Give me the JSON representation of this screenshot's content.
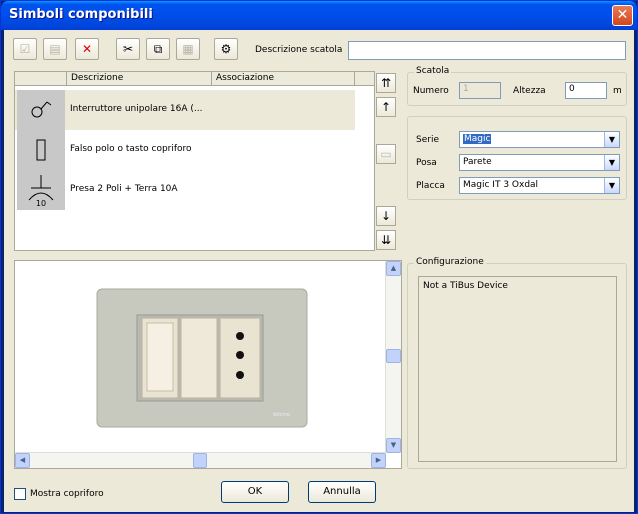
{
  "window": {
    "title": "Simboli componibili",
    "close_glyph": "✕"
  },
  "toolbar": {
    "buttons": [
      {
        "icon": "edit-icon",
        "glyph": "☑",
        "enabled": false
      },
      {
        "icon": "properties-icon",
        "glyph": "▤",
        "enabled": false
      },
      {
        "icon": "delete-icon",
        "glyph": "✕",
        "enabled": true
      },
      {
        "icon": "cut-icon",
        "glyph": "✂",
        "enabled": true
      },
      {
        "icon": "copy-icon",
        "glyph": "⧉",
        "enabled": true
      },
      {
        "icon": "paste-icon",
        "glyph": "▦",
        "enabled": false
      },
      {
        "icon": "settings-icon",
        "glyph": "⚙",
        "enabled": true
      }
    ],
    "descrizione_scatola_label": "Descrizione scatola",
    "descrizione_scatola_value": ""
  },
  "list": {
    "columns": [
      "Descrizione",
      "Associazione"
    ],
    "rows": [
      {
        "description": "Interruttore unipolare 16A (...",
        "association": "",
        "symbol": "switch-symbol-icon",
        "selected": true
      },
      {
        "description": "Falso polo o tasto copriforo",
        "association": "",
        "symbol": "blank-symbol-icon",
        "selected": false
      },
      {
        "description": "Presa 2 Poli + Terra 10A",
        "association": "",
        "symbol": "socket-symbol-icon",
        "selected": false
      }
    ],
    "socket_symbol_text": "10"
  },
  "side_buttons": {
    "top": "⇈",
    "up": "↑",
    "middle": "▭",
    "down": "↓",
    "bottom": "⇊"
  },
  "scatola": {
    "title": "Scatola",
    "numero_label": "Numero",
    "numero_value": "1",
    "altezza_label": "Altezza",
    "altezza_value": "0",
    "unit": "m"
  },
  "settings": {
    "serie_label": "Serie",
    "serie_value": "Magic",
    "posa_label": "Posa",
    "posa_value": "Parete",
    "placca_label": "Placca",
    "placca_value": "Magic IT 3 Oxdal"
  },
  "configurazione": {
    "title": "Configurazione",
    "text": "Not a TiBus Device"
  },
  "preview": {
    "brand": "bticino"
  },
  "footer": {
    "mostra_copriforo_label": "Mostra copriforo",
    "mostra_copriforo_checked": false,
    "ok_label": "OK",
    "annulla_label": "Annulla"
  },
  "colors": {
    "title_bar": "#0053ee",
    "dialog_bg": "#ece9d8",
    "selection": "#316ac5",
    "close_button": "#d2461d"
  }
}
